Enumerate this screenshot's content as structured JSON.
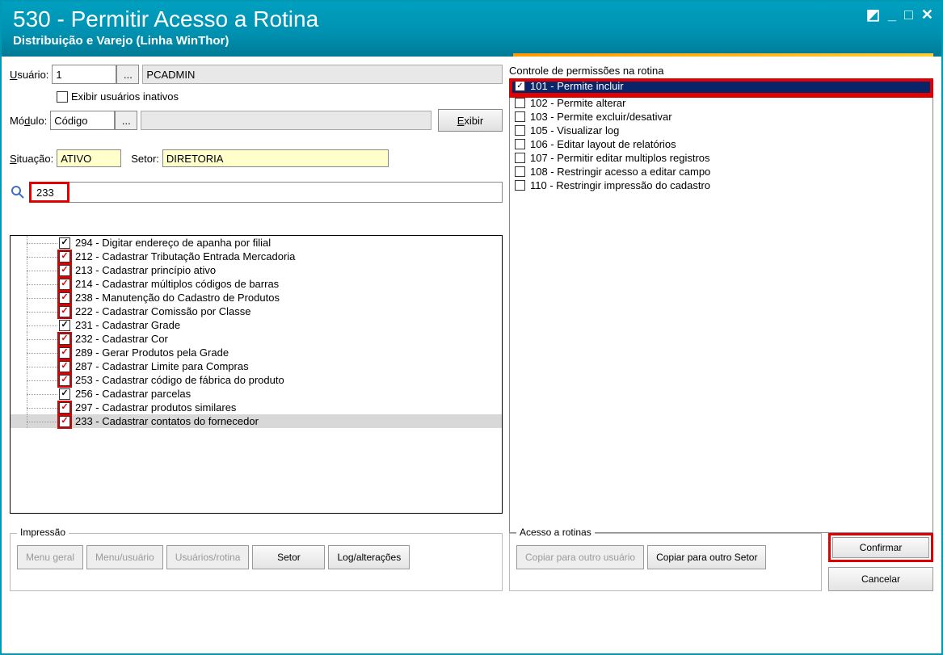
{
  "window": {
    "title": "530 - Permitir Acesso a Rotina",
    "subtitle": "Distribuição e Varejo (Linha WinThor)"
  },
  "form": {
    "usuario_label": "Usuário:",
    "usuario_value": "1",
    "usuario_name": "PCADMIN",
    "inativos_label": "Exibir usuários inativos",
    "modulo_label": "Módulo:",
    "modulo_value": "Código",
    "modulo_name": "",
    "exibir_label": "Exibir",
    "situacao_label": "Situação:",
    "situacao_value": "ATIVO",
    "setor_label": "Setor:",
    "setor_value": "DIRETORIA",
    "search_value": "233"
  },
  "tree": {
    "items": [
      {
        "label": "294 - Digitar endereço de apanha por filial",
        "checked": true,
        "style": "black"
      },
      {
        "label": "212 - Cadastrar Tributação Entrada Mercadoria",
        "checked": true,
        "style": "red"
      },
      {
        "label": "213 - Cadastrar princípio ativo",
        "checked": true,
        "style": "red"
      },
      {
        "label": "214 - Cadastrar múltiplos códigos de barras",
        "checked": true,
        "style": "red"
      },
      {
        "label": "238 - Manutenção do Cadastro de Produtos",
        "checked": true,
        "style": "red"
      },
      {
        "label": "222 - Cadastrar Comissão por Classe",
        "checked": true,
        "style": "red"
      },
      {
        "label": "231 - Cadastrar Grade",
        "checked": true,
        "style": "black"
      },
      {
        "label": "232 - Cadastrar Cor",
        "checked": true,
        "style": "red"
      },
      {
        "label": "289 - Gerar Produtos pela Grade",
        "checked": true,
        "style": "red"
      },
      {
        "label": "287 - Cadastrar Limite para Compras",
        "checked": true,
        "style": "red"
      },
      {
        "label": "253 - Cadastrar código de fábrica do produto",
        "checked": true,
        "style": "red"
      },
      {
        "label": "256 - Cadastrar parcelas",
        "checked": true,
        "style": "black"
      },
      {
        "label": "297 - Cadastrar produtos similares",
        "checked": true,
        "style": "red"
      },
      {
        "label": "233 - Cadastrar contatos do fornecedor",
        "checked": true,
        "style": "red",
        "selected": true
      }
    ]
  },
  "permissions": {
    "title": "Controle de permissões na rotina",
    "items": [
      {
        "label": "101 - Permite incluir",
        "checked": true,
        "selected": true
      },
      {
        "label": "102 - Permite alterar",
        "checked": false
      },
      {
        "label": "103 - Permite excluir/desativar",
        "checked": false
      },
      {
        "label": "105 - Visualizar log",
        "checked": false
      },
      {
        "label": "106 - Editar layout de relatórios",
        "checked": false
      },
      {
        "label": "107 - Permitir editar multiplos registros",
        "checked": false
      },
      {
        "label": "108 - Restringir acesso a editar campo",
        "checked": false
      },
      {
        "label": "110 - Restringir impressão do cadastro",
        "checked": false
      }
    ]
  },
  "impressao": {
    "title": "Impressão",
    "menu_geral": "Menu geral",
    "menu_usuario": "Menu/usuário",
    "usuarios_rotina": "Usuários/rotina",
    "setor": "Setor",
    "log": "Log/alterações"
  },
  "acesso": {
    "title": "Acesso a rotinas",
    "copiar_usuario": "Copiar para outro usuário",
    "copiar_setor": "Copiar para outro Setor"
  },
  "actions": {
    "confirmar": "Confirmar",
    "cancelar": "Cancelar"
  }
}
